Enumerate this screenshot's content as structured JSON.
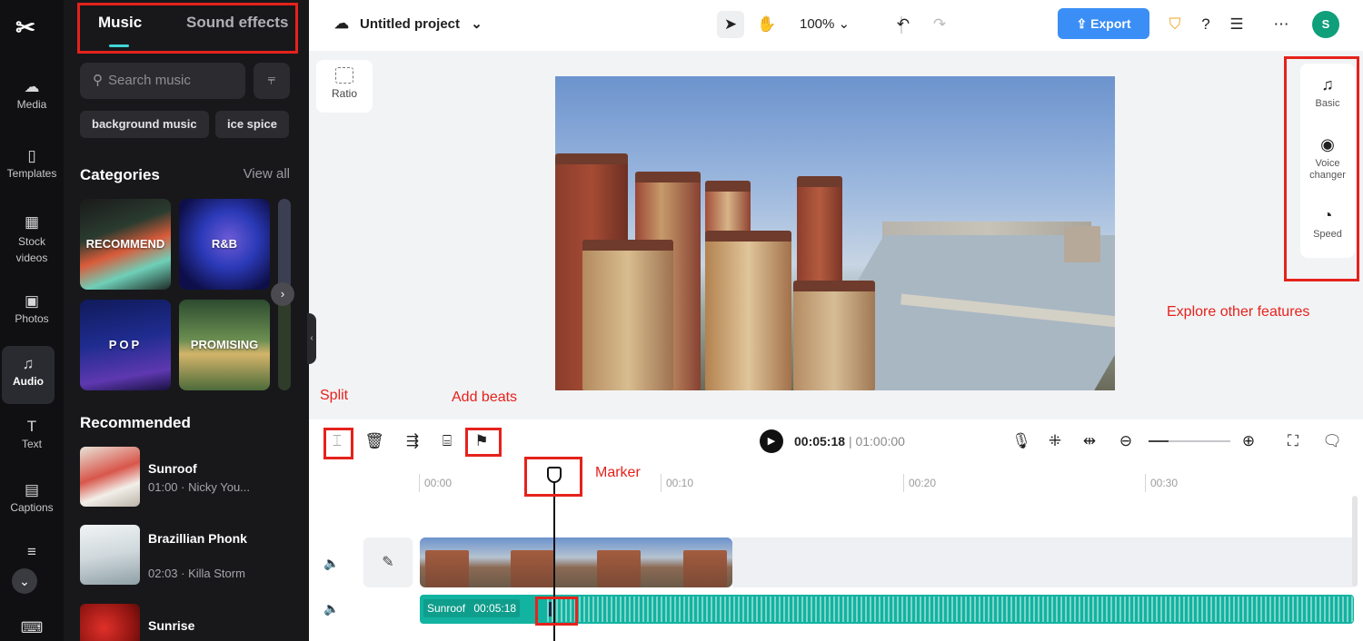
{
  "left_rail": {
    "items": [
      {
        "label": "Media",
        "icon": "media-cloud-icon"
      },
      {
        "label": "Templates",
        "icon": "templates-icon"
      },
      {
        "label": "Stock videos",
        "icon": "stock-videos-icon"
      },
      {
        "label": "Photos",
        "icon": "photos-icon"
      },
      {
        "label": "Audio",
        "icon": "audio-note-icon"
      },
      {
        "label": "Text",
        "icon": "text-icon"
      },
      {
        "label": "Captions",
        "icon": "captions-icon"
      },
      {
        "label": "",
        "icon": "transcript-icon"
      },
      {
        "label": "",
        "icon": "keyboard-icon"
      }
    ],
    "active": "Audio"
  },
  "panel": {
    "tabs": [
      "Music",
      "Sound effects"
    ],
    "active_tab": "Music",
    "search_placeholder": "Search music",
    "chips": [
      "background music",
      "ice spice"
    ],
    "categories_title": "Categories",
    "view_all": "View all",
    "categories": [
      "RECOMMEND",
      "R&B",
      "POP",
      "PROMISING"
    ],
    "recommended_title": "Recommended",
    "tracks": [
      {
        "title": "Sunroof",
        "meta": "01:00 · Nicky You..."
      },
      {
        "title": "Brazillian Phonk",
        "meta": "02:03 · Killa Storm"
      },
      {
        "title": "Sunrise",
        "meta": ""
      }
    ]
  },
  "topbar": {
    "project_title": "Untitled project",
    "zoom": "100%",
    "export_label": "Export",
    "avatar_letter": "S"
  },
  "preview": {
    "ratio_label": "Ratio"
  },
  "right_panel": {
    "items": [
      {
        "label": "Basic",
        "icon": "music-note-icon"
      },
      {
        "label": "Voice changer",
        "icon": "voice-changer-icon"
      },
      {
        "label": "Speed",
        "icon": "speed-gauge-icon"
      }
    ]
  },
  "annotations": {
    "split": "Split",
    "add_beats": "Add beats",
    "marker": "Marker",
    "explore": "Explore other features",
    "color": "#e5221c"
  },
  "timeline": {
    "current_time": "00:05:18",
    "separator": "|",
    "duration": "01:00:00",
    "ruler": [
      "00:00",
      "00:10",
      "00:20",
      "00:30"
    ],
    "audio_clip_name": "Sunroof",
    "audio_clip_time": "00:05:18"
  },
  "colors": {
    "accent_teal": "#12b3a0",
    "export_blue": "#3a8ef5",
    "tab_underline": "#3fd6d6"
  }
}
